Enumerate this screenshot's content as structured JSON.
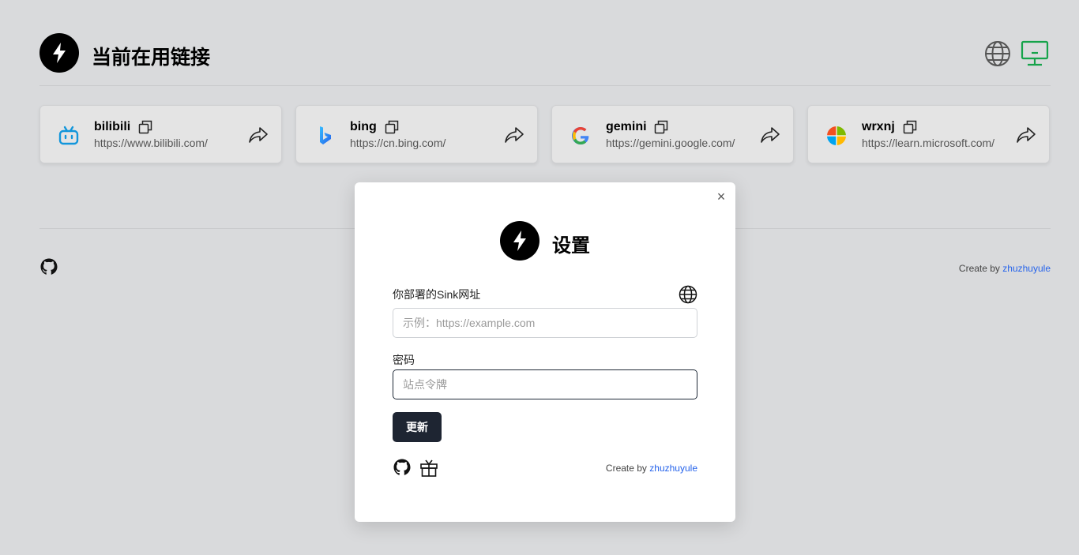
{
  "header": {
    "title": "当前在用链接",
    "accent_color": "#16a34a"
  },
  "links": [
    {
      "name": "bilibili",
      "url": "https://www.bilibili.com/",
      "icon": "bilibili-icon"
    },
    {
      "name": "bing",
      "url": "https://cn.bing.com/",
      "icon": "bing-icon"
    },
    {
      "name": "gemini",
      "url": "https://gemini.google.com/",
      "icon": "google-icon"
    },
    {
      "name": "wrxnj",
      "url": "https://learn.microsoft.com/",
      "icon": "microsoft-icon"
    }
  ],
  "footer": {
    "credit_prefix": "Create by",
    "credit_author": "zhuzhuyule"
  },
  "modal": {
    "close_label": "×",
    "title": "设置",
    "url_label": "你部署的Sink网址",
    "url_placeholder": "示例：https://example.com",
    "url_value": "",
    "password_label": "密码",
    "password_placeholder": "站点令牌",
    "password_value": "",
    "submit_label": "更新",
    "credit_prefix": "Create by",
    "credit_author": "zhuzhuyule"
  }
}
